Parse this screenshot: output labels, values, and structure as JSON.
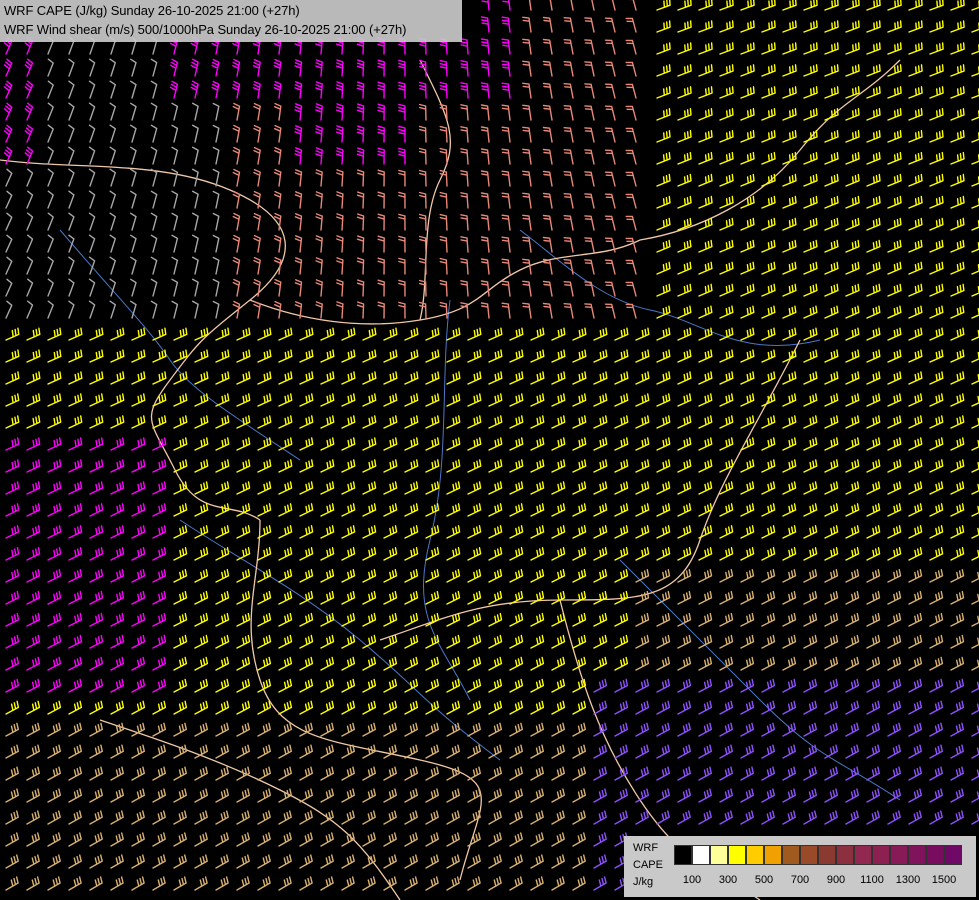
{
  "title": {
    "line1": "WRF CAPE (J/kg) Sunday 26-10-2025 21:00 (+27h)",
    "line2": "WRF Wind shear (m/s) 500/1000hPa Sunday 26-10-2025 21:00 (+27h)"
  },
  "legend": {
    "label1": "WRF",
    "label2": "CAPE",
    "label3": "J/kg",
    "swatches": [
      "#000000",
      "#ffffff",
      "#ffff99",
      "#ffff00",
      "#ffcc00",
      "#f0a000",
      "#a05a20",
      "#9a4a28",
      "#8a3a30",
      "#8c3040",
      "#922850",
      "#8c2050",
      "#881a58",
      "#80145c",
      "#7a0c60",
      "#700868"
    ],
    "ticks": [
      "100",
      "300",
      "500",
      "700",
      "900",
      "1100",
      "1300",
      "1500"
    ]
  },
  "colors": {
    "barb_gray": "#a8a8a8",
    "barb_salmon": "#e88878",
    "barb_magenta": "#ff00ff",
    "barb_yellow": "#ffff00",
    "barb_tan": "#d8b070",
    "barb_purple": "#9050ff",
    "border": "#f0c8a8",
    "river": "#4a78c8"
  }
}
